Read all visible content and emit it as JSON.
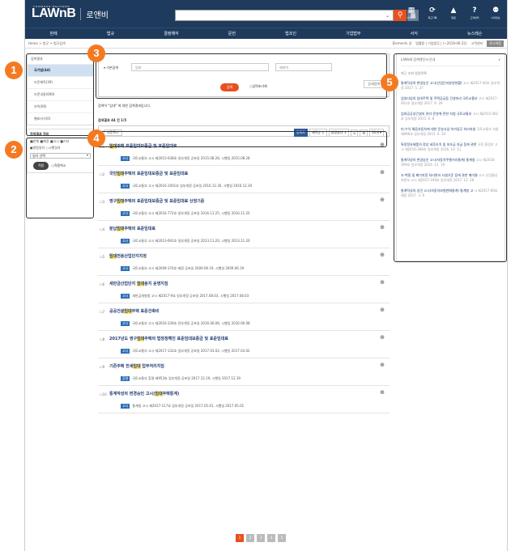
{
  "app": {
    "logo": "LAWnB",
    "logo_tag": "THOMSON REUTERS",
    "logo_ko": "로앤비"
  },
  "top_icons": [
    {
      "glyph": "▦",
      "label": "나의원비"
    },
    {
      "glyph": "⟳",
      "label": "최근기록"
    },
    {
      "glyph": "▲",
      "label": "알림"
    },
    {
      "glyph": "?",
      "label": "고객센터"
    },
    {
      "glyph": "⚉",
      "label": "나의정보"
    }
  ],
  "nav": [
    "판례",
    "법규",
    "결정해석",
    "문헌",
    "법조인",
    "기업법무",
    "서식",
    "뉴스레슨"
  ],
  "breadcrumb": "Home > 법규 > 법규검색",
  "crumb_right": [
    "Elements 일",
    "법률용 | 기업법무 | (~2018-06-22)",
    "고객센터"
  ],
  "crumb_btn": "로그아웃",
  "sidebar": {
    "title": "검색결과",
    "items": [
      {
        "label": "국가법(44)",
        "active": true
      },
      {
        "label": "조문제목(39)"
      },
      {
        "label": "조문내용(690)"
      },
      {
        "label": "부칙(66)"
      },
      {
        "label": "별표서식(0)"
      }
    ],
    "filter_title": "검색결과 정리",
    "filter_row1": "■현행 ■예정 ■고시 ■기타",
    "filter_row2": "●발령일자 ○시행일자",
    "filter_select": "일자 선택",
    "apply": "적용",
    "reset": "○적용취소"
  },
  "search": {
    "label": "▾ 기본검색",
    "placeholder": "임대",
    "placeholder2": "제외어",
    "go": "검색",
    "reset": "○입력초기화",
    "advanced": "상세검색"
  },
  "result_msg": "검색어 \"임대\" 에 대한 검색결과입니다.",
  "result_count": "검색결과 44 건 1/5",
  "toolbar": {
    "download": "다운로드",
    "tools": [
      "정확도",
      "제목순 ↕",
      "발령일자 ↕",
      "≡",
      "☰",
      "10개 ▾"
    ]
  },
  "results": [
    {
      "num": "1",
      "pre": "",
      "hl": "임대",
      "post": "주택 표준임대보증금 및 표준임대료",
      "tag": "고시",
      "meta": "국토교통부 고시 제2015-638호 일부개정 공포일 2015.08.28, 시행일 2015.08.28"
    },
    {
      "num": "2",
      "pre": "국민",
      "hl": "임대",
      "post": "주택의 표준임대보증금 및 표준임대료",
      "tag": "고시",
      "meta": "국토교통부 고시 제2016-1001호 일부개정 공포일 2016.12.30, 시행일 2016.12.30"
    },
    {
      "num": "3",
      "pre": "영구",
      "hl": "임대",
      "post": "주택의 표준임대보증금 및 표준임대료 산정기준",
      "tag": "고시",
      "meta": "국토교통부 고시 제2016-772호 일부개정 공포일 2016.11.25, 시행일 2016.11.25"
    },
    {
      "num": "4",
      "pre": "분납",
      "hl": "임대",
      "post": "주택의 표준임대료",
      "tag": "고시",
      "meta": "국토교통부 고시 제2013-691호 일부개정 공포일 2013.11.20, 시행일 2013.11.20"
    },
    {
      "num": "5",
      "pre": "",
      "hl": "임대",
      "post": "전용산업단지지정",
      "tag": "고시",
      "meta": "국토교통부 고시 제2009-374호 제정 공포일 2009.06.19, 시행일 2009.06.19"
    },
    {
      "num": "6",
      "pre": "새만금산업단지 ",
      "hl": "임대",
      "post": "용지 운영지침",
      "tag": "고시",
      "meta": "새만금개발청 고시 제2017-9호 일부개정 공포일 2017.08.03, 시행일 2017.08.03"
    },
    {
      "num": "7",
      "pre": "공공건설",
      "hl": "임대",
      "post": "주택 표준건축비",
      "tag": "고시",
      "meta": "국토교통부 고시 제2016-339호 전부개정 공포일 2016.06.08, 시행일 2016.06.08"
    },
    {
      "num": "8",
      "pre": "2017년도 영구",
      "hl": "임대",
      "post": "주택의 법정정해진 표준임대보증금 및 표준임대료",
      "tag": "고시",
      "meta": "국토교통부 고시 제2017-132호 일부개정 공포일 2017.03.02, 시행일 2017.03.02"
    },
    {
      "num": "9",
      "pre": "기존주택 전세",
      "hl": "임대",
      "post": " 업무처리지침",
      "tag": "훈령",
      "meta": "국토교통부 훈령 제953호 일부개정 공포일 2017.12.19, 시행일 2017.12.19"
    },
    {
      "num": "10",
      "pre": "통계작성의 변경승인 고시(",
      "hl": "임대",
      "post": "주택통계)",
      "tag": "고시",
      "meta": "통계청 고시 제2017-117호 일부개정 공포일 2017.05.01, 시행일 2017.05.01"
    }
  ],
  "pager": [
    "1",
    "2",
    "3",
    "4",
    "5"
  ],
  "right": {
    "header": "LAWnB 검색엔진서 안내",
    "sub": "최근 조회 법령목록",
    "items": [
      {
        "title": "통계작성의 변경승인 고시(산업단지분양현황)",
        "meta": "고시 제2017-40호 일부개정 2017. 1. 27"
      },
      {
        "title": "임대사업의 임대주택 및 주택공급등 건설처리 국토교통부",
        "meta": "고시 제2017-461호 일부개정 2017. 9. 29"
      },
      {
        "title": "임대공공성건설지 관리·운영에 관한 지침 국토교통부",
        "meta": "고시 제2015-462호 일부개정 2015. 6. 8"
      },
      {
        "title": "미·수익 해음자동차에 대한 운송사업 허가업무 처리지침",
        "meta": "국토교통부 지침 제996호 일부개정 2015. 6. 24"
      },
      {
        "title": "특정정유제품의 정상 세후조치 및 보조금 지급 등에 관한",
        "meta": "규정 환경부 고시 제2016-186호 일부개정 2016. 10. 11"
      },
      {
        "title": "통계작성의 변경승인 고시(자동차주행거리통계) 통계청",
        "meta": "고시 제2016-399호 일부개정 2016. 12. 19"
      },
      {
        "title": "조·벽질 및 폐기지정 처리관리 사설기준 등에 관한 폐기물",
        "meta": "고시 산업통상자원부 고시 제2017-194호 일부개정 2017. 12. 28"
      },
      {
        "title": "통계작성의 승인 고시(자동차보험판매통계) 통계청 고",
        "meta": "시 제2017-60호 제정 2017. 3. 6"
      }
    ]
  },
  "callouts": [
    "1",
    "2",
    "3",
    "4",
    "5"
  ]
}
